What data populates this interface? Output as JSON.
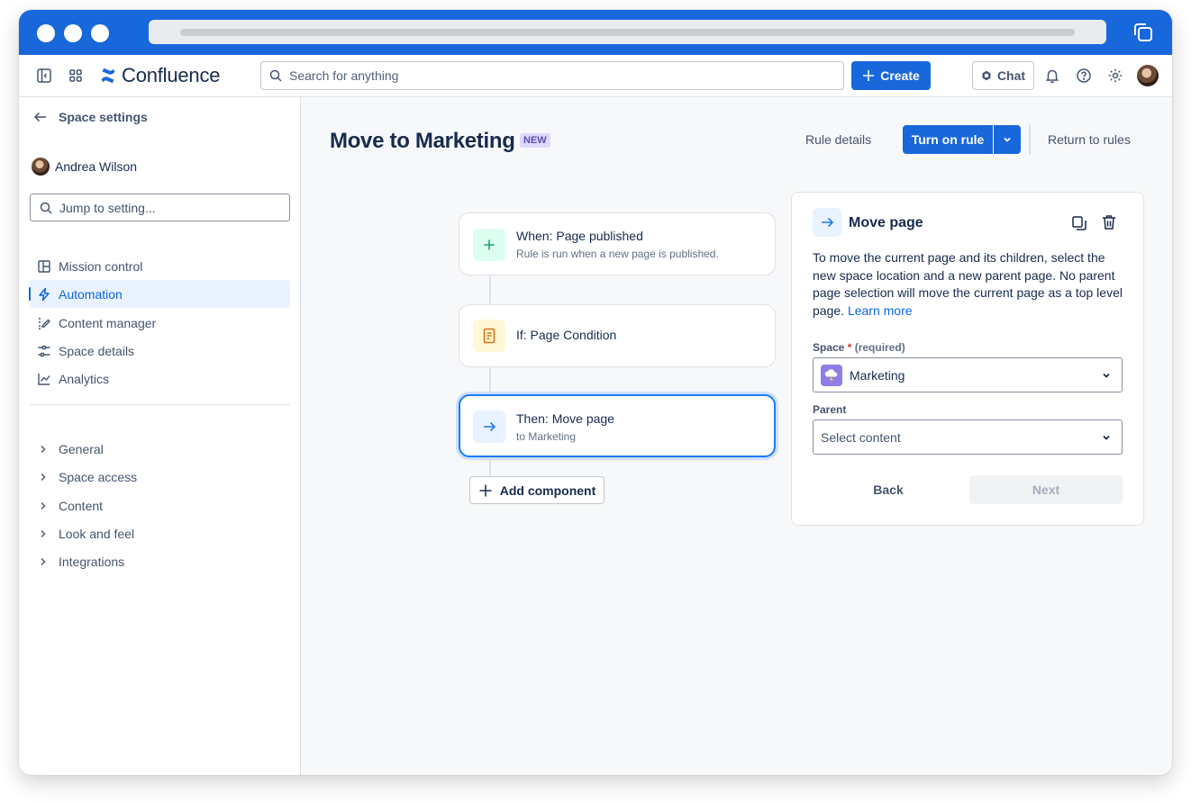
{
  "topnav": {
    "brand": "Confluence",
    "search_placeholder": "Search for anything",
    "create_label": "Create",
    "chat_label": "Chat"
  },
  "sidebar": {
    "back_label": "Space settings",
    "user_name": "Andrea Wilson",
    "search_placeholder": "Jump to setting...",
    "items": [
      {
        "label": "Mission control",
        "icon": "layout-icon"
      },
      {
        "label": "Automation",
        "icon": "lightning-icon",
        "active": true
      },
      {
        "label": "Content manager",
        "icon": "content-manager-icon"
      },
      {
        "label": "Space details",
        "icon": "sliders-icon"
      },
      {
        "label": "Analytics",
        "icon": "chart-line-icon"
      }
    ],
    "groups": [
      "General",
      "Space access",
      "Content",
      "Look and feel",
      "Integrations"
    ]
  },
  "main": {
    "title": "Move to Marketing",
    "badge": "NEW",
    "rule_details_label": "Rule details",
    "turn_on_label": "Turn on rule",
    "return_label": "Return to rules",
    "flow": [
      {
        "title": "When: Page published",
        "subtitle": "Rule is run when a new page is published.",
        "icon": "plus-icon",
        "color": "#22a06b"
      },
      {
        "title": "If: Page Condition",
        "subtitle": "",
        "icon": "page-icon",
        "color": "#e2b203"
      },
      {
        "title": "Then: Move page",
        "subtitle": "to Marketing",
        "icon": "arrow-right-icon",
        "color": "#1d7afc"
      }
    ],
    "add_component_label": "Add component"
  },
  "panel": {
    "title": "Move page",
    "description": "To move the current page and its children, select the new space location and a new parent page. No parent page selection will move the current page as a top level page.",
    "learn_more": "Learn more",
    "space_label": "Space",
    "space_required_mark": "*",
    "space_required_text": "(required)",
    "space_value": "Marketing",
    "parent_label": "Parent",
    "parent_placeholder": "Select content",
    "back_label": "Back",
    "next_label": "Next"
  },
  "colors": {
    "brand_blue": "#1868db",
    "active_blue": "#0c66e4",
    "badge_purple": "#dfd8fd"
  }
}
